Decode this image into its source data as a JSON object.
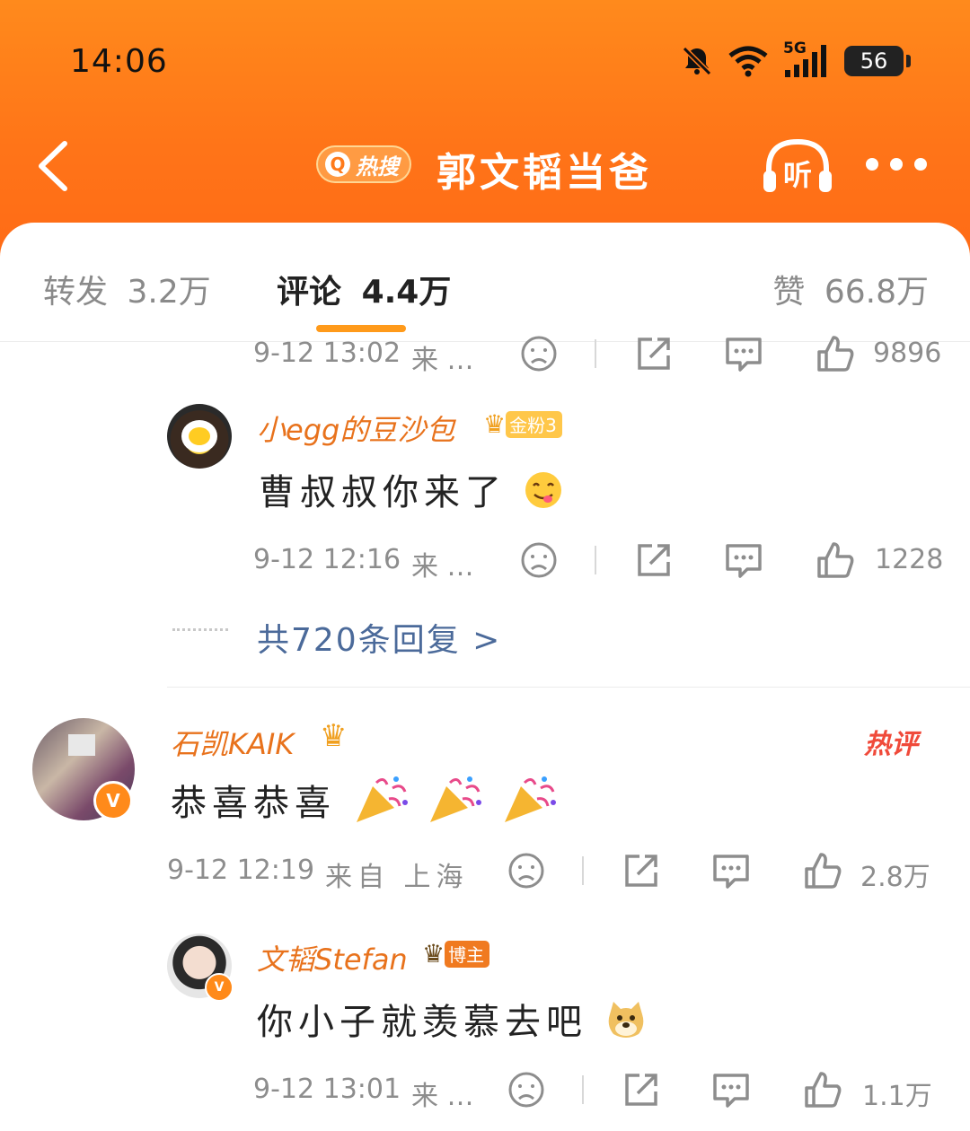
{
  "status_bar": {
    "time": "14:06",
    "network": "5G",
    "battery": "56"
  },
  "nav": {
    "hot_badge": "热搜",
    "title": "郭文韬当爸",
    "listen": "听"
  },
  "tabs": {
    "repost": {
      "label": "转发",
      "count": "3.2万"
    },
    "comment": {
      "label": "评论",
      "count": "4.4万"
    },
    "like": {
      "label": "赞",
      "count": "66.8万"
    }
  },
  "comments": [
    {
      "time": "9-12 13:02",
      "source": "来 …",
      "likes": "9896"
    },
    {
      "user": "小egg的豆沙包",
      "badge": "金粉3",
      "text": "曹叔叔你来了",
      "time": "9-12 12:16",
      "source": "来 …",
      "likes": "1228"
    },
    {
      "replies_link": "共720条回复 >"
    },
    {
      "user": "石凯KAIK",
      "tag": "热评",
      "text": "恭喜恭喜",
      "time": "9-12 12:19",
      "source": "来自 上海",
      "likes": "2.8万"
    },
    {
      "user": "文韬Stefan",
      "badge": "博主",
      "text": "你小子就羡慕去吧",
      "time": "9-12 13:01",
      "source": "来 …",
      "likes": "1.1万"
    }
  ],
  "colors": {
    "accent": "#ff7a1a",
    "username": "#e8721c",
    "link": "#4b6a9a",
    "hot": "#f04a3a"
  }
}
